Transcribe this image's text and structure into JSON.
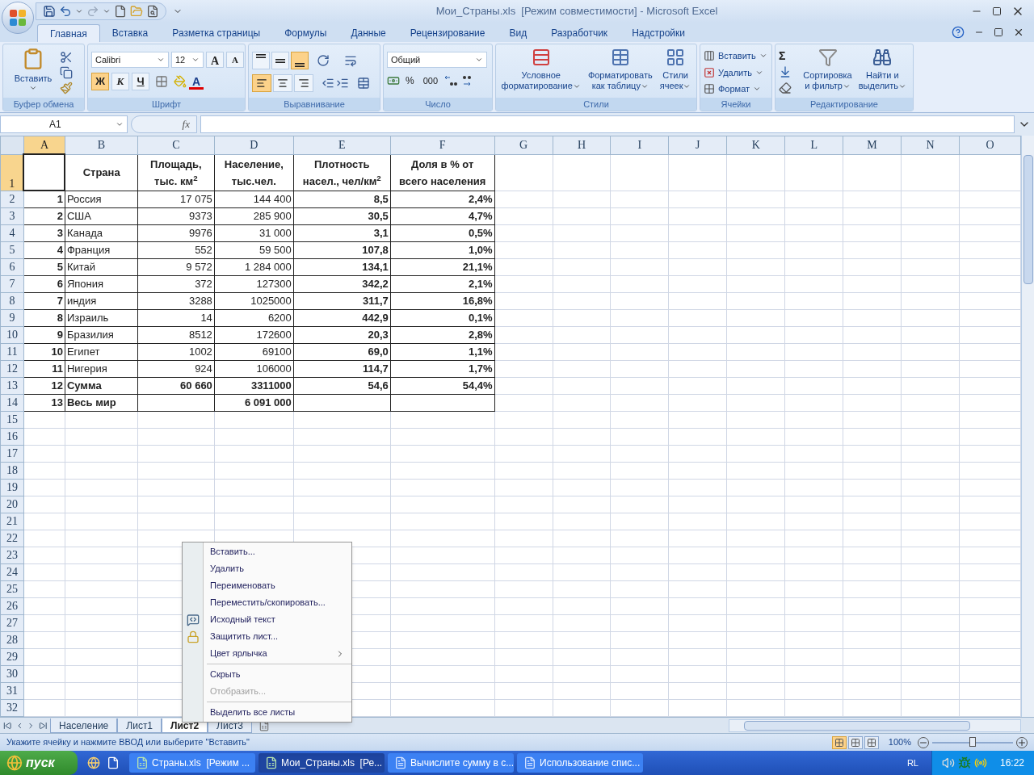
{
  "window": {
    "title": "Мои_Страны.xls  [Режим совместимости] - Microsoft Excel"
  },
  "ribbon_tabs": [
    {
      "label": "Главная",
      "selected": true
    },
    {
      "label": "Вставка",
      "selected": false
    },
    {
      "label": "Разметка страницы",
      "selected": false
    },
    {
      "label": "Формулы",
      "selected": false
    },
    {
      "label": "Данные",
      "selected": false
    },
    {
      "label": "Рецензирование",
      "selected": false
    },
    {
      "label": "Вид",
      "selected": false
    },
    {
      "label": "Разработчик",
      "selected": false
    },
    {
      "label": "Надстройки",
      "selected": false
    }
  ],
  "clipboard": {
    "label": "Буфер обмена",
    "paste": "Вставить"
  },
  "font": {
    "label": "Шрифт",
    "name": "Calibri",
    "size": "12",
    "grow": "A",
    "shrink": "A",
    "bold": {
      "label": "Ж",
      "on": true
    },
    "italic": {
      "label": "К",
      "on": false
    },
    "underline": {
      "label": "Ч",
      "on": false
    },
    "color_letter": "A"
  },
  "alignment": {
    "label": "Выравнивание",
    "vertical": [
      {
        "selected": false
      },
      {
        "selected": false
      },
      {
        "selected": true
      }
    ],
    "horizontal": [
      {
        "selected": true
      },
      {
        "selected": false
      },
      {
        "selected": false
      }
    ]
  },
  "number": {
    "label": "Число",
    "format": "Общий",
    "percent": "%",
    "thousands": "000"
  },
  "styles": {
    "label": "Стили",
    "buttons": [
      {
        "lines": [
          "Условное",
          "форматирование"
        ]
      },
      {
        "lines": [
          "Форматировать",
          "как таблицу"
        ]
      },
      {
        "lines": [
          "Стили",
          "ячеек"
        ]
      }
    ]
  },
  "cells_group": {
    "label": "Ячейки",
    "buttons": [
      "Вставить",
      "Удалить",
      "Формат"
    ]
  },
  "editing": {
    "label": "Редактирование",
    "autosum": "Σ",
    "buttons": [
      {
        "lines": [
          "Сортировка",
          "и фильтр"
        ]
      },
      {
        "lines": [
          "Найти и",
          "выделить"
        ]
      }
    ]
  },
  "formula_bar": {
    "name_box": "A1",
    "fx": "fx"
  },
  "sheet": {
    "columns": [
      {
        "label": "A",
        "selected": true
      },
      {
        "label": "B",
        "selected": false
      },
      {
        "label": "C",
        "selected": false
      },
      {
        "label": "D",
        "selected": false
      },
      {
        "label": "E",
        "selected": false
      },
      {
        "label": "F",
        "selected": false
      },
      {
        "label": "G",
        "selected": false
      },
      {
        "label": "H",
        "selected": false
      },
      {
        "label": "I",
        "selected": false
      },
      {
        "label": "J",
        "selected": false
      },
      {
        "label": "K",
        "selected": false
      },
      {
        "label": "L",
        "selected": false
      },
      {
        "label": "M",
        "selected": false
      },
      {
        "label": "N",
        "selected": false
      },
      {
        "label": "O",
        "selected": false
      }
    ],
    "row_numbers": [
      {
        "label": "1",
        "selected": true
      },
      {
        "label": "2",
        "selected": false
      },
      {
        "label": "3",
        "selected": false
      },
      {
        "label": "4",
        "selected": false
      },
      {
        "label": "5",
        "selected": false
      },
      {
        "label": "6",
        "selected": false
      },
      {
        "label": "7",
        "selected": false
      },
      {
        "label": "8",
        "selected": false
      },
      {
        "label": "9",
        "selected": false
      },
      {
        "label": "10",
        "selected": false
      },
      {
        "label": "11",
        "selected": false
      },
      {
        "label": "12",
        "selected": false
      },
      {
        "label": "13",
        "selected": false
      },
      {
        "label": "14",
        "selected": false
      },
      {
        "label": "15",
        "selected": false
      },
      {
        "label": "16",
        "selected": false
      },
      {
        "label": "17",
        "selected": false
      },
      {
        "label": "18",
        "selected": false
      },
      {
        "label": "19",
        "selected": false
      },
      {
        "label": "20",
        "selected": false
      },
      {
        "label": "21",
        "selected": false
      },
      {
        "label": "22",
        "selected": false
      },
      {
        "label": "23",
        "selected": false
      },
      {
        "label": "24",
        "selected": false
      },
      {
        "label": "25",
        "selected": false
      },
      {
        "label": "26",
        "selected": false
      },
      {
        "label": "27",
        "selected": false
      },
      {
        "label": "28",
        "selected": false
      },
      {
        "label": "29",
        "selected": false
      },
      {
        "label": "30",
        "selected": false
      },
      {
        "label": "31",
        "selected": false
      },
      {
        "label": "32",
        "selected": false
      }
    ],
    "header_cells": [
      null,
      "Страна",
      "Площадь, тыс. км$^{2}$",
      "Население, тыс.чел.",
      "Плотность насел., чел/км$^{2}$",
      "Доля в % от всего населения"
    ],
    "data_rows": [
      {
        "cells": [
          "1",
          "Россия",
          "17 075",
          "144 400",
          "8,5",
          "2,4%"
        ],
        "total": false
      },
      {
        "cells": [
          "2",
          "США",
          "9373",
          "285 900",
          "30,5",
          "4,7%"
        ],
        "total": false
      },
      {
        "cells": [
          "3",
          "Канада",
          "9976",
          "31 000",
          "3,1",
          "0,5%"
        ],
        "total": false
      },
      {
        "cells": [
          "4",
          "Франция",
          "552",
          "59 500",
          "107,8",
          "1,0%"
        ],
        "total": false
      },
      {
        "cells": [
          "5",
          "Китай",
          "9 572",
          "1 284 000",
          "134,1",
          "21,1%"
        ],
        "total": false
      },
      {
        "cells": [
          "6",
          "Япония",
          "372",
          "127300",
          "342,2",
          "2,1%"
        ],
        "total": false
      },
      {
        "cells": [
          "7",
          "индия",
          "3288",
          "1025000",
          "311,7",
          "16,8%"
        ],
        "total": false
      },
      {
        "cells": [
          "8",
          "Израиль",
          "14",
          "6200",
          "442,9",
          "0,1%"
        ],
        "total": false
      },
      {
        "cells": [
          "9",
          "Бразилия",
          "8512",
          "172600",
          "20,3",
          "2,8%"
        ],
        "total": false
      },
      {
        "cells": [
          "10",
          "Египет",
          "1002",
          "69100",
          "69,0",
          "1,1%"
        ],
        "total": false
      },
      {
        "cells": [
          "11",
          "Нигерия",
          "924",
          "106000",
          "114,7",
          "1,7%"
        ],
        "total": false
      },
      {
        "cells": [
          "12",
          "Сумма",
          "60 660",
          "3311000",
          "54,6",
          "54,4%"
        ],
        "total": true
      },
      {
        "cells": [
          "13",
          "Весь мир",
          null,
          "6 091 000",
          null,
          null
        ],
        "total": true
      }
    ]
  },
  "sheet_tabs": [
    {
      "label": "Население",
      "selected": false
    },
    {
      "label": "Лист1",
      "selected": false
    },
    {
      "label": "Лист2",
      "selected": true
    },
    {
      "label": "Лист3",
      "selected": false
    }
  ],
  "context_menu": [
    {
      "kind": "plain",
      "label": "Вставить...",
      "disabled": false
    },
    {
      "kind": "plain",
      "label": "Удалить",
      "disabled": false
    },
    {
      "kind": "plain",
      "label": "Переименовать",
      "disabled": false
    },
    {
      "kind": "plain",
      "label": "Переместить/скопировать...",
      "disabled": false
    },
    {
      "kind": "source",
      "label": "Исходный текст",
      "disabled": false
    },
    {
      "kind": "protect",
      "label": "Защитить лист...",
      "disabled": false
    },
    {
      "kind": "submenu",
      "label": "Цвет ярлычка",
      "disabled": false
    },
    {
      "kind": "separator"
    },
    {
      "kind": "plain",
      "label": "Скрыть",
      "disabled": false
    },
    {
      "kind": "plain",
      "label": "Отобразить...",
      "disabled": true
    },
    {
      "kind": "separator"
    },
    {
      "kind": "plain",
      "label": "Выделить все листы",
      "disabled": false
    }
  ],
  "status_bar": {
    "message": "Укажите ячейку и нажмите ВВОД или выберите \"Вставить\"",
    "views": [
      {
        "selected": true
      },
      {
        "selected": false
      },
      {
        "selected": false
      }
    ],
    "zoom": "100%",
    "zoom_slider": {
      "level": 0.5
    }
  },
  "taskbar": {
    "start": "пуск",
    "tasks": [
      {
        "kind": "excel",
        "label": "Страны.xls  [Режим ...",
        "selected": false
      },
      {
        "kind": "excel",
        "label": "Мои_Страны.xls  [Ре...",
        "selected": true
      },
      {
        "kind": "word",
        "label": "Вычислите сумму в с...",
        "selected": false
      },
      {
        "kind": "word",
        "label": "Использование спис...",
        "selected": false
      }
    ],
    "language": "RL",
    "clock": "16:22"
  }
}
